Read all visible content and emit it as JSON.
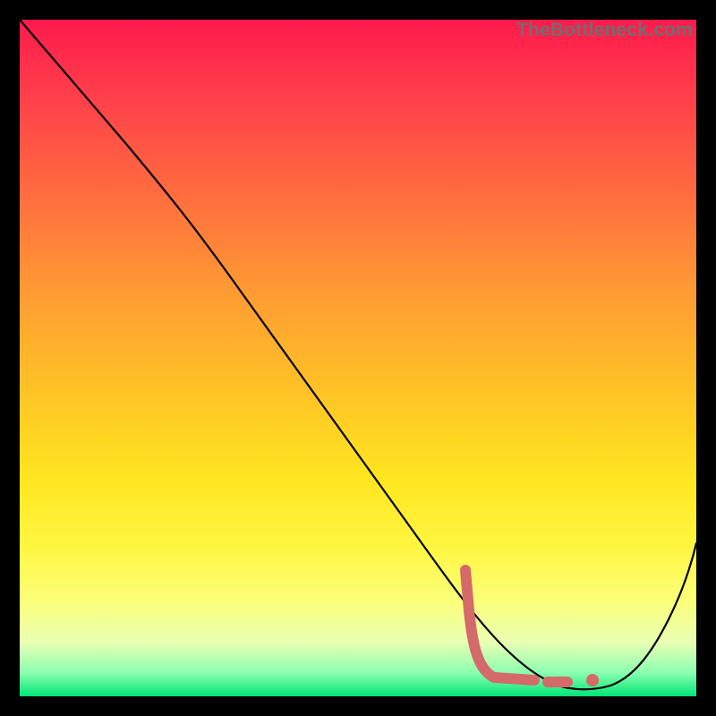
{
  "watermark": "TheBottleneck.com",
  "colors": {
    "frame_bg": "#000000",
    "line": "#000000",
    "marker": "#d46a6a",
    "gradient_top": "#ff1a4d",
    "gradient_bottom": "#00e676"
  },
  "chart_data": {
    "type": "line",
    "title": "",
    "xlabel": "",
    "ylabel": "",
    "xlim": [
      0,
      100
    ],
    "ylim": [
      0,
      100
    ],
    "grid": false,
    "legend": false,
    "series": [
      {
        "name": "bottleneck-curve",
        "x": [
          0,
          5,
          10,
          15,
          20,
          25,
          30,
          35,
          40,
          45,
          50,
          55,
          60,
          65,
          70,
          75,
          80,
          82,
          85,
          90,
          95,
          100
        ],
        "y": [
          100,
          94,
          88,
          82,
          77,
          72,
          67,
          60,
          53,
          46,
          39,
          32,
          25,
          18,
          12,
          6,
          2,
          1,
          1,
          7,
          17,
          30
        ]
      }
    ],
    "markers": {
      "name": "highlight-region",
      "segments": [
        {
          "x": [
            65,
            65.3,
            70,
            75
          ],
          "y": [
            19,
            12,
            3,
            2
          ]
        }
      ],
      "dots": [
        {
          "x": 78,
          "y": 2
        },
        {
          "x": 80,
          "y": 2
        },
        {
          "x": 83,
          "y": 2
        }
      ]
    },
    "note": "Axis values are fractional [0–100] estimates read from pixel positions; the source image has no tick labels."
  }
}
